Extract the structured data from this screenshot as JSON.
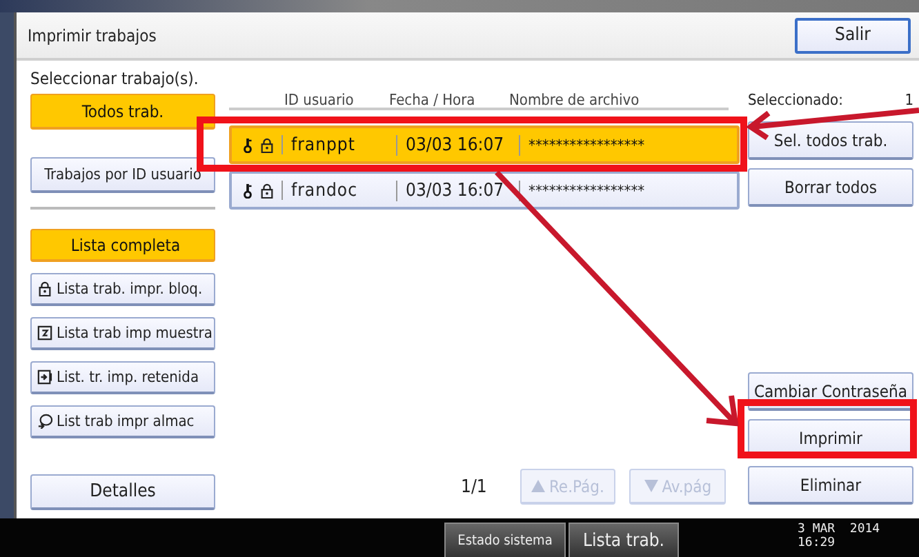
{
  "window": {
    "title": "Imprimir trabajos",
    "exit_button": "Salir"
  },
  "instruction": "Seleccionar trabajo(s).",
  "filter_tabs": [
    {
      "label": "Todos trab.",
      "selected": true
    },
    {
      "label": "Trabajos por ID usuario",
      "selected": false
    }
  ],
  "list_types": [
    {
      "label": "Lista completa",
      "kind": "all",
      "selected": true
    },
    {
      "label": "Lista trab. impr. bloq.",
      "kind": "locked",
      "selected": false
    },
    {
      "label": "Lista trab imp muestra",
      "kind": "sample",
      "selected": false
    },
    {
      "label": "List. tr. imp. retenida",
      "kind": "hold",
      "selected": false
    },
    {
      "label": "List trab impr almac",
      "kind": "stored",
      "selected": false
    }
  ],
  "details_button": "Detalles",
  "jobs": {
    "columns": [
      "ID usuario",
      "Fecha / Hora",
      "Nombre de archivo"
    ],
    "rows": [
      {
        "user": "franppt",
        "time": "03/03 16:07",
        "file": "*****************",
        "selected": true
      },
      {
        "user": "frandoc",
        "time": "03/03 16:07",
        "file": "*****************",
        "selected": false
      }
    ]
  },
  "selected_count": {
    "label": "Seleccionado:",
    "value": "1"
  },
  "top_actions": [
    "Sel. todos trab.",
    "Borrar todos"
  ],
  "bottom_actions": [
    "Cambiar Contraseña",
    "Imprimir",
    "Eliminar"
  ],
  "pager": {
    "page": "1/1",
    "buttons": [
      {
        "label": "Re.Pág.",
        "kind": "up",
        "disabled": true
      },
      {
        "label": "Av.pág",
        "kind": "down",
        "disabled": true
      }
    ]
  },
  "taskbar": {
    "buttons": [
      "Estado sistema",
      "Lista trab."
    ],
    "date": "3 MAR  2014",
    "time": "16:29"
  }
}
